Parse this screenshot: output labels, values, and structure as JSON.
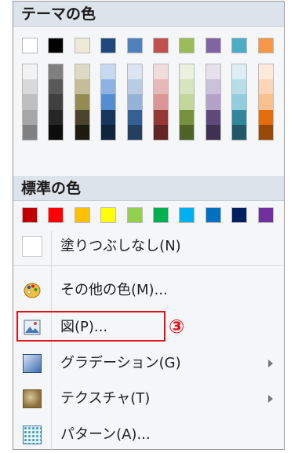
{
  "theme_colors": {
    "title": "テーマの色",
    "base": [
      "#ffffff",
      "#000000",
      "#ece9d8",
      "#1f497d",
      "#4f81bd",
      "#c0504d",
      "#9bbb59",
      "#8064a2",
      "#4bacc6",
      "#f79646"
    ],
    "shades": [
      [
        "#f2f2f2",
        "#d9d9d9",
        "#bfbfbf",
        "#a6a6a6",
        "#808080"
      ],
      [
        "#7f7f7f",
        "#595959",
        "#404040",
        "#262626",
        "#0d0d0d"
      ],
      [
        "#ddd9c3",
        "#c4bd97",
        "#948a54",
        "#4a452a",
        "#1d1b10"
      ],
      [
        "#c6d9f1",
        "#8db3e2",
        "#548dd4",
        "#17365d",
        "#0f243e"
      ],
      [
        "#dbe5f1",
        "#b8cce4",
        "#95b3d7",
        "#366092",
        "#244061"
      ],
      [
        "#f2dcdb",
        "#e6b9b8",
        "#d99694",
        "#953735",
        "#632523"
      ],
      [
        "#ebf1de",
        "#d7e4bd",
        "#c3d69b",
        "#76923c",
        "#4f6228"
      ],
      [
        "#e5e0ec",
        "#ccc1da",
        "#b2a2c7",
        "#5f497a",
        "#3f3151"
      ],
      [
        "#dbeef4",
        "#b7dee8",
        "#93cddd",
        "#31859c",
        "#215968"
      ],
      [
        "#fdeada",
        "#fbd5b5",
        "#fac08f",
        "#e46c0a",
        "#984807"
      ]
    ]
  },
  "standard_colors": {
    "title": "標準の色",
    "colors": [
      "#c00000",
      "#ff0000",
      "#ffc000",
      "#ffff00",
      "#92d050",
      "#00b050",
      "#00b0f0",
      "#0070c0",
      "#002060",
      "#7030a0"
    ]
  },
  "menu_items": [
    {
      "label": "塗りつぶしなし(N)",
      "icon": "empty-box-icon",
      "has_submenu": false
    },
    {
      "label": "その他の色(M)...",
      "icon": "palette-icon",
      "has_submenu": false
    },
    {
      "label": "図(P)...",
      "icon": "picture-icon",
      "has_submenu": false
    },
    {
      "label": "グラデーション(G)",
      "icon": "gradient-icon",
      "has_submenu": true
    },
    {
      "label": "テクスチャ(T)",
      "icon": "texture-icon",
      "has_submenu": true
    },
    {
      "label": "パターン(A)...",
      "icon": "pattern-icon",
      "has_submenu": false
    }
  ],
  "annotation": {
    "callout": "③",
    "highlight_color": "#e3101c"
  }
}
